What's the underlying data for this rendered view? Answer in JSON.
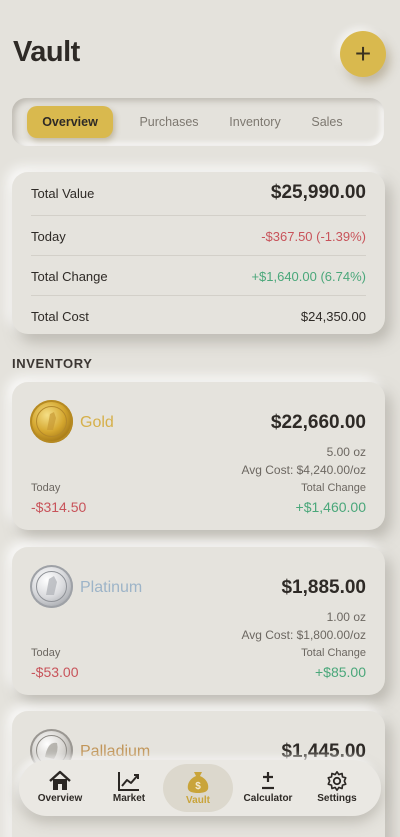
{
  "header": {
    "title": "Vault",
    "add_symbol": "+"
  },
  "tabs": [
    {
      "label": "Overview",
      "active": true
    },
    {
      "label": "Purchases",
      "active": false
    },
    {
      "label": "Inventory",
      "active": false
    },
    {
      "label": "Sales",
      "active": false
    }
  ],
  "summary": {
    "total_value_label": "Total Value",
    "total_value": "$25,990.00",
    "today_label": "Today",
    "today_value": "-$367.50 (-1.39%)",
    "total_change_label": "Total Change",
    "total_change_value": "+$1,640.00 (6.74%)",
    "total_cost_label": "Total Cost",
    "total_cost_value": "$24,350.00"
  },
  "inventory_title": "INVENTORY",
  "metals": [
    {
      "name": "Gold",
      "value": "$22,660.00",
      "weight": "5.00 oz",
      "avg_cost": "Avg Cost: $4,240.00/oz",
      "today_label": "Today",
      "today_value": "-$314.50",
      "change_label": "Total Change",
      "change_value": "+$1,460.00"
    },
    {
      "name": "Platinum",
      "value": "$1,885.00",
      "weight": "1.00 oz",
      "avg_cost": "Avg Cost: $1,800.00/oz",
      "today_label": "Today",
      "today_value": "-$53.00",
      "change_label": "Total Change",
      "change_value": "+$85.00"
    },
    {
      "name": "Palladium",
      "value": "$1,445.00"
    }
  ],
  "nav": [
    {
      "label": "Overview",
      "icon": "home-icon"
    },
    {
      "label": "Market",
      "icon": "chart-icon"
    },
    {
      "label": "Vault",
      "icon": "money-bag-icon",
      "active": true
    },
    {
      "label": "Calculator",
      "icon": "plus-minus-icon"
    },
    {
      "label": "Settings",
      "icon": "gear-icon"
    }
  ],
  "colors": {
    "accent": "#d9b94e",
    "background": "#e4e2dc",
    "negative": "#c8535a",
    "positive": "#4aa77a"
  }
}
